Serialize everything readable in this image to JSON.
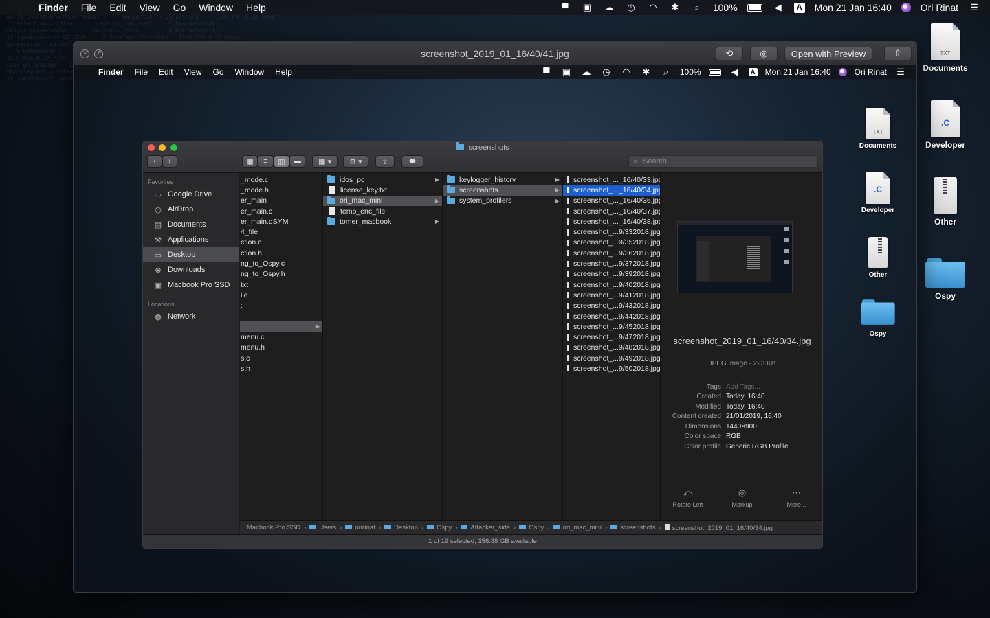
{
  "menubar": {
    "app": "Finder",
    "items": [
      "File",
      "Edit",
      "View",
      "Go",
      "Window",
      "Help"
    ],
    "battery": "100%",
    "datetime": "Mon 21 Jan  16:40",
    "user": "Ori Rinat",
    "keyboard": "A"
  },
  "desktop": {
    "icons": [
      {
        "label": "Documents",
        "badge": "TXT",
        "kind": "doc"
      },
      {
        "label": "Developer",
        "badge": ".C",
        "kind": "c-doc"
      },
      {
        "label": "Other",
        "badge": "ZIP",
        "kind": "zip"
      },
      {
        "label": "Ospy",
        "kind": "folder"
      }
    ]
  },
  "quicklook": {
    "title": "screenshot_2019_01_16/40/41.jpg",
    "open_with_label": "Open with Preview",
    "inner_menubar": {
      "app": "Finder",
      "items": [
        "File",
        "Edit",
        "View",
        "Go",
        "Window",
        "Help"
      ],
      "battery": "100%",
      "datetime": "Mon 21 Jan  16:40",
      "user": "Ori Rinat",
      "keyboard": "A"
    },
    "inner_desktop": [
      {
        "label": "Documents",
        "badge": "TXT"
      },
      {
        "label": "Developer",
        "badge": ".C"
      },
      {
        "label": "Other",
        "badge": "ZIP"
      },
      {
        "label": "Ospy"
      }
    ]
  },
  "finder": {
    "title": "screenshots",
    "search_placeholder": "Search",
    "sidebar": {
      "favorites_header": "Favorites",
      "favorites": [
        {
          "label": "Google Drive",
          "icon": "folder-icon"
        },
        {
          "label": "AirDrop",
          "icon": "airdrop-icon"
        },
        {
          "label": "Documents",
          "icon": "documents-icon"
        },
        {
          "label": "Applications",
          "icon": "applications-icon"
        },
        {
          "label": "Desktop",
          "icon": "desktop-icon",
          "selected": true
        },
        {
          "label": "Downloads",
          "icon": "downloads-icon"
        },
        {
          "label": "Macbook Pro SSD",
          "icon": "disk-icon"
        }
      ],
      "locations_header": "Locations",
      "locations": [
        {
          "label": "Network",
          "icon": "network-icon"
        }
      ]
    },
    "column1": [
      "_mode.c",
      "_mode.h",
      "er_main",
      "er_main.c",
      "er_main.dSYM",
      "4_file",
      "ction.c",
      "ction.h",
      "ng_to_Ospy.c",
      "ng_to_Ospy.h",
      "txt",
      "ile",
      ":",
      "",
      "",
      "menu.c",
      "menu.h",
      "s.c",
      "s.h"
    ],
    "column2": [
      {
        "name": "idos_pc",
        "type": "folder"
      },
      {
        "name": "license_key.txt",
        "type": "file"
      },
      {
        "name": "ori_mac_mini",
        "type": "folder",
        "selected": true
      },
      {
        "name": "temp_enc_file",
        "type": "file"
      },
      {
        "name": "tomer_macbook",
        "type": "folder"
      }
    ],
    "column3": [
      {
        "name": "keylogger_history",
        "type": "folder"
      },
      {
        "name": "screenshots",
        "type": "folder",
        "selected": true
      },
      {
        "name": "system_profilers",
        "type": "folder"
      }
    ],
    "column4": [
      "screenshot_..._16/40/33.jpg",
      "screenshot_..._16/40/34.jpg",
      "screenshot_..._16/40/36.jpg",
      "screenshot_..._16/40/37.jpg",
      "screenshot_..._16/40/38.jpg",
      "screenshot_...9/332018.jpg",
      "screenshot_...9/352018.jpg",
      "screenshot_...9/362018.jpg",
      "screenshot_...9/372018.jpg",
      "screenshot_...9/392018.jpg",
      "screenshot_...9/402018.jpg",
      "screenshot_...9/412018.jpg",
      "screenshot_...9/432018.jpg",
      "screenshot_...9/442018.jpg",
      "screenshot_...9/452018.jpg",
      "screenshot_...9/472018.jpg",
      "screenshot_...9/482018.jpg",
      "screenshot_...9/492018.jpg",
      "screenshot_...9/502018.jpg"
    ],
    "column4_active_index": 1,
    "preview": {
      "filename": "screenshot_2019_01_16/40/34.jpg",
      "kind": "JPEG image - 223 KB",
      "meta": [
        {
          "k": "Tags",
          "v": "Add Tags...",
          "placeholder": true
        },
        {
          "k": "Created",
          "v": "Today, 16:40"
        },
        {
          "k": "Modified",
          "v": "Today, 16:40"
        },
        {
          "k": "Content created",
          "v": "21/01/2019, 16:40"
        },
        {
          "k": "Dimensions",
          "v": "1440×900"
        },
        {
          "k": "Color space",
          "v": "RGB"
        },
        {
          "k": "Color profile",
          "v": "Generic RGB Profile"
        }
      ],
      "actions": [
        {
          "label": "Rotate Left",
          "icon": "rotate-left-icon",
          "glyph": "⤺"
        },
        {
          "label": "Markup",
          "icon": "markup-icon",
          "glyph": "◎"
        },
        {
          "label": "More...",
          "icon": "more-icon",
          "glyph": "⋯"
        }
      ]
    },
    "path": [
      "Macbook Pro SSD",
      "Users",
      "orirínat",
      "Desktop",
      "Ospy",
      "Attacker_side",
      "Ospy",
      "ori_mac_mini",
      "screenshots",
      "screenshot_2019_01_16/40/34.jpg"
    ],
    "status": "1 of 19 selected, 156.88 GB available"
  }
}
